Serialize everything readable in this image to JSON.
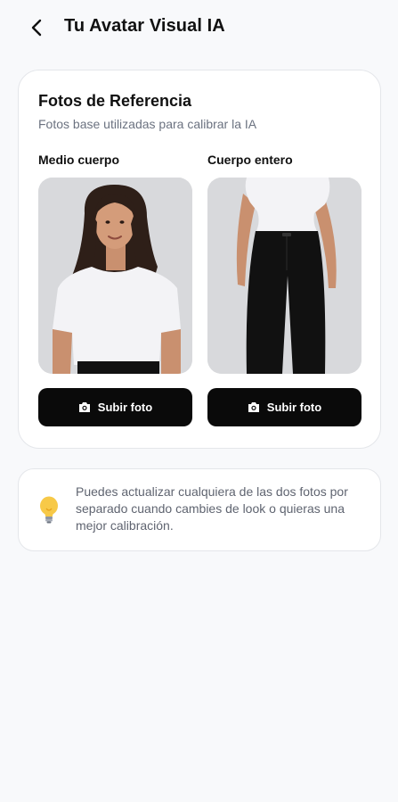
{
  "header": {
    "title": "Tu Avatar Visual IA",
    "back_icon": "chevron-left-icon"
  },
  "reference_card": {
    "title": "Fotos de Referencia",
    "subtitle": "Fotos base utilizadas para calibrar la IA",
    "columns": [
      {
        "label": "Medio cuerpo",
        "image": "half-body-photo",
        "button_label": "Subir foto",
        "button_icon": "camera-icon"
      },
      {
        "label": "Cuerpo entero",
        "image": "full-body-photo",
        "button_label": "Subir foto",
        "button_icon": "camera-icon"
      }
    ]
  },
  "tip": {
    "icon": "lightbulb-icon",
    "text": "Puedes actualizar cualquiera de las dos fotos por separado cuando cambies de look o quieras una mejor calibración."
  },
  "colors": {
    "background": "#f8f9fb",
    "card": "#ffffff",
    "button": "#0a0a0a",
    "muted_text": "#6b7280"
  }
}
